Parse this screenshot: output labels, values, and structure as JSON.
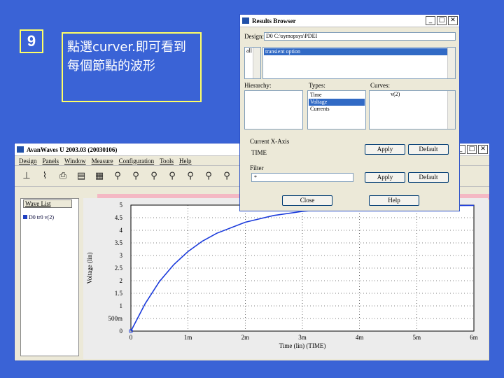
{
  "slide": {
    "step_number": "9",
    "caption": "點選curver.即可看到每個節點的波形"
  },
  "avanwaves": {
    "title": "AvanWaves U 2003.03 (20030106)",
    "menu": [
      "Design",
      "Panels",
      "Window",
      "Measure",
      "Configuration",
      "Tools",
      "Help"
    ],
    "wave_list_label": "Wave List",
    "wave_item": "D0 tr0 v(2)",
    "y_axis_label": "Voltage (lin)",
    "x_axis_label": "Time (lin) (TIME)",
    "y_ticks": [
      "5",
      "4.5",
      "4",
      "3.5",
      "3",
      "2.5",
      "2",
      "1.5",
      "1",
      "500m",
      "0"
    ],
    "x_ticks": [
      "0",
      "1m",
      "2m",
      "3m",
      "4m",
      "5m",
      "6m"
    ]
  },
  "chart_data": {
    "type": "line",
    "xlabel": "Time (lin) (TIME)",
    "ylabel": "Voltage (lin)",
    "xlim": [
      0,
      6
    ],
    "ylim": [
      0,
      5
    ],
    "x_unit": "m",
    "series": [
      {
        "x": [
          0,
          0.25,
          0.5,
          0.75,
          1.0,
          1.25,
          1.5,
          2.0,
          2.5,
          3.0,
          3.5,
          4.0,
          4.5,
          5.0,
          5.5,
          6.0
        ],
        "y": [
          0,
          1.09,
          1.97,
          2.64,
          3.16,
          3.57,
          3.88,
          4.32,
          4.59,
          4.75,
          4.85,
          4.91,
          4.94,
          4.97,
          4.98,
          4.99
        ]
      }
    ],
    "grid": true,
    "line_color": "#1a3adb"
  },
  "results_browser": {
    "title": "Results Browser",
    "design_label": "Design:",
    "design_value": "D0  C:\\symopsys\\PDEI",
    "file_label": "all",
    "file_value": "transient  option",
    "hierarchy_label": "Hierarchy:",
    "types_label": "Types:",
    "types": [
      "Time",
      "Voltage",
      "Currents"
    ],
    "curves_label": "Curves:",
    "curves_value": "v(2)",
    "xaxis_label": "Current X-Axis",
    "xaxis_value": "TIME",
    "apply_label": "Apply",
    "default_label": "Default",
    "filter_label": "Filter",
    "filter_value": "*",
    "close_label": "Close",
    "help_label": "Help"
  }
}
